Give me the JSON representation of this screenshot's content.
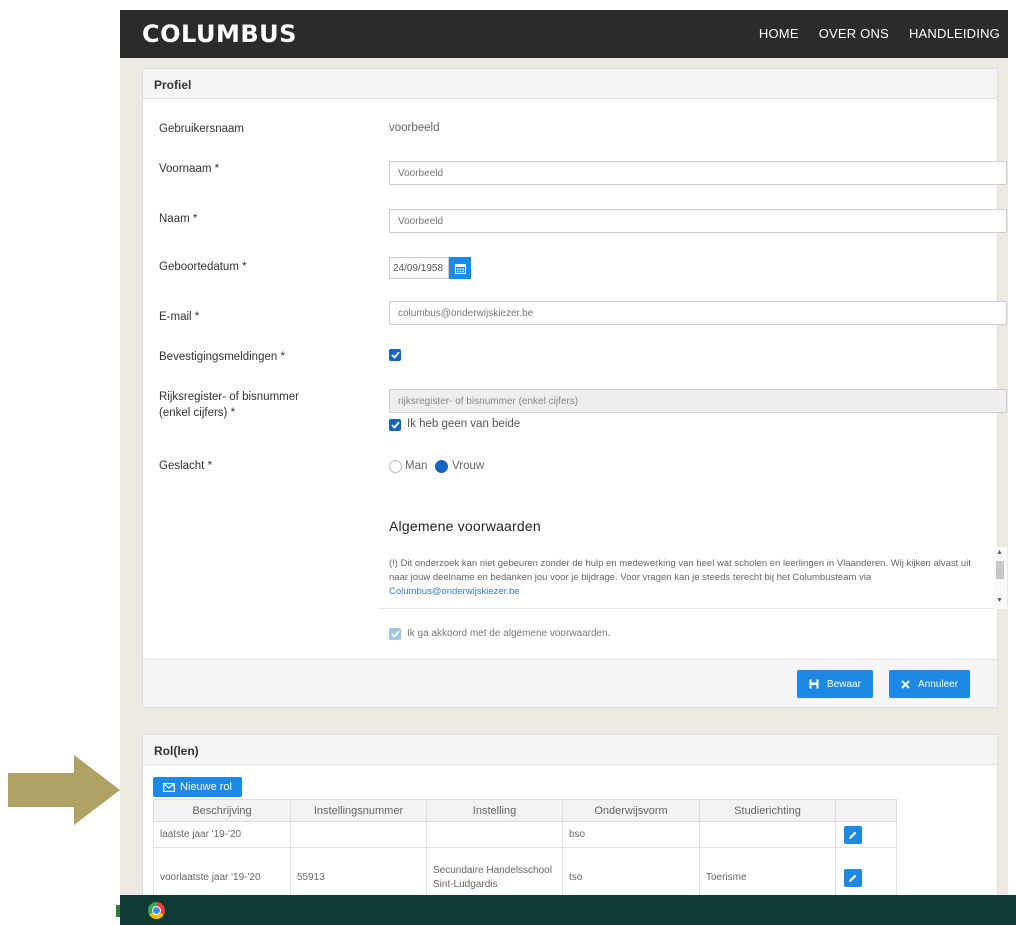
{
  "header": {
    "logo": "COLUMBUS",
    "nav": [
      "HOME",
      "OVER ONS",
      "HANDLEIDING"
    ]
  },
  "profile": {
    "title": "Profiel",
    "username_label": "Gebruikersnaam",
    "username_value": "voorbeeld",
    "firstname_label": "Voornaam *",
    "firstname_value": "Voorbeeld",
    "lastname_label": "Naam *",
    "lastname_value": "Voorbeeld",
    "birthdate_label": "Geboortedatum *",
    "birthdate_value": "24/09/1958",
    "email_label": "E-mail *",
    "email_value": "columbus@onderwijskiezer.be",
    "confirm_label": "Bevestigingsmeldingen *",
    "confirm_checked": true,
    "rrn_label_1": "Rijksregister- of bisnummer",
    "rrn_label_2": "(enkel cijfers) *",
    "rrn_placeholder": "rijksregister- of bisnummer (enkel cijfers)",
    "rrn_none_label": "Ik heb geen van beide",
    "rrn_none_checked": true,
    "gender_label": "Geslacht *",
    "gender_options": [
      "Man",
      "Vrouw"
    ],
    "gender_selected": "Vrouw",
    "terms_title": "Algemene voorwaarden",
    "terms_text": "(!) Dit onderzoek kan niet gebeuren zonder de hulp en medewerking van heel wat scholen en leerlingen in Vlaanderen. Wij kijken alvast uit naar jouw deelname en bedanken jou voor je bijdrage. Voor vragen kan je steeds terecht bij het Columbusteam via ",
    "terms_link": "Columbus@onderwijskiezer.be",
    "terms_agree_label": "Ik ga akkoord met de algemene voorwaarden.",
    "save_label": "Bewaar",
    "cancel_label": "Annuleer"
  },
  "roles": {
    "title": "Rol(len)",
    "new_role_label": "Nieuwe rol",
    "columns": [
      "Beschrijving",
      "Instellingsnummer",
      "Instelling",
      "Onderwijsvorm",
      "Studierichting"
    ],
    "rows": [
      {
        "beschrijving": "laatste jaar '19-'20",
        "instellingsnummer": "",
        "instelling": "",
        "onderwijsvorm": "bso",
        "studierichting": ""
      },
      {
        "beschrijving": "voorlaatste jaar '19-'20",
        "instellingsnummer": "55913",
        "instelling": "Secundaire Handelsschool Sint-Ludgardis",
        "onderwijsvorm": "tso",
        "studierichting": "Toerisme"
      }
    ]
  },
  "colors": {
    "accent": "#1e88e5",
    "topbar": "#2b2b2b",
    "arrow": "#b0a264",
    "taskbar": "#0f3a34"
  },
  "icons": [
    "calendar-icon",
    "check-icon",
    "save-icon",
    "close-icon",
    "envelope-icon",
    "pencil-icon",
    "chrome-icon",
    "arrow-right-icon"
  ]
}
